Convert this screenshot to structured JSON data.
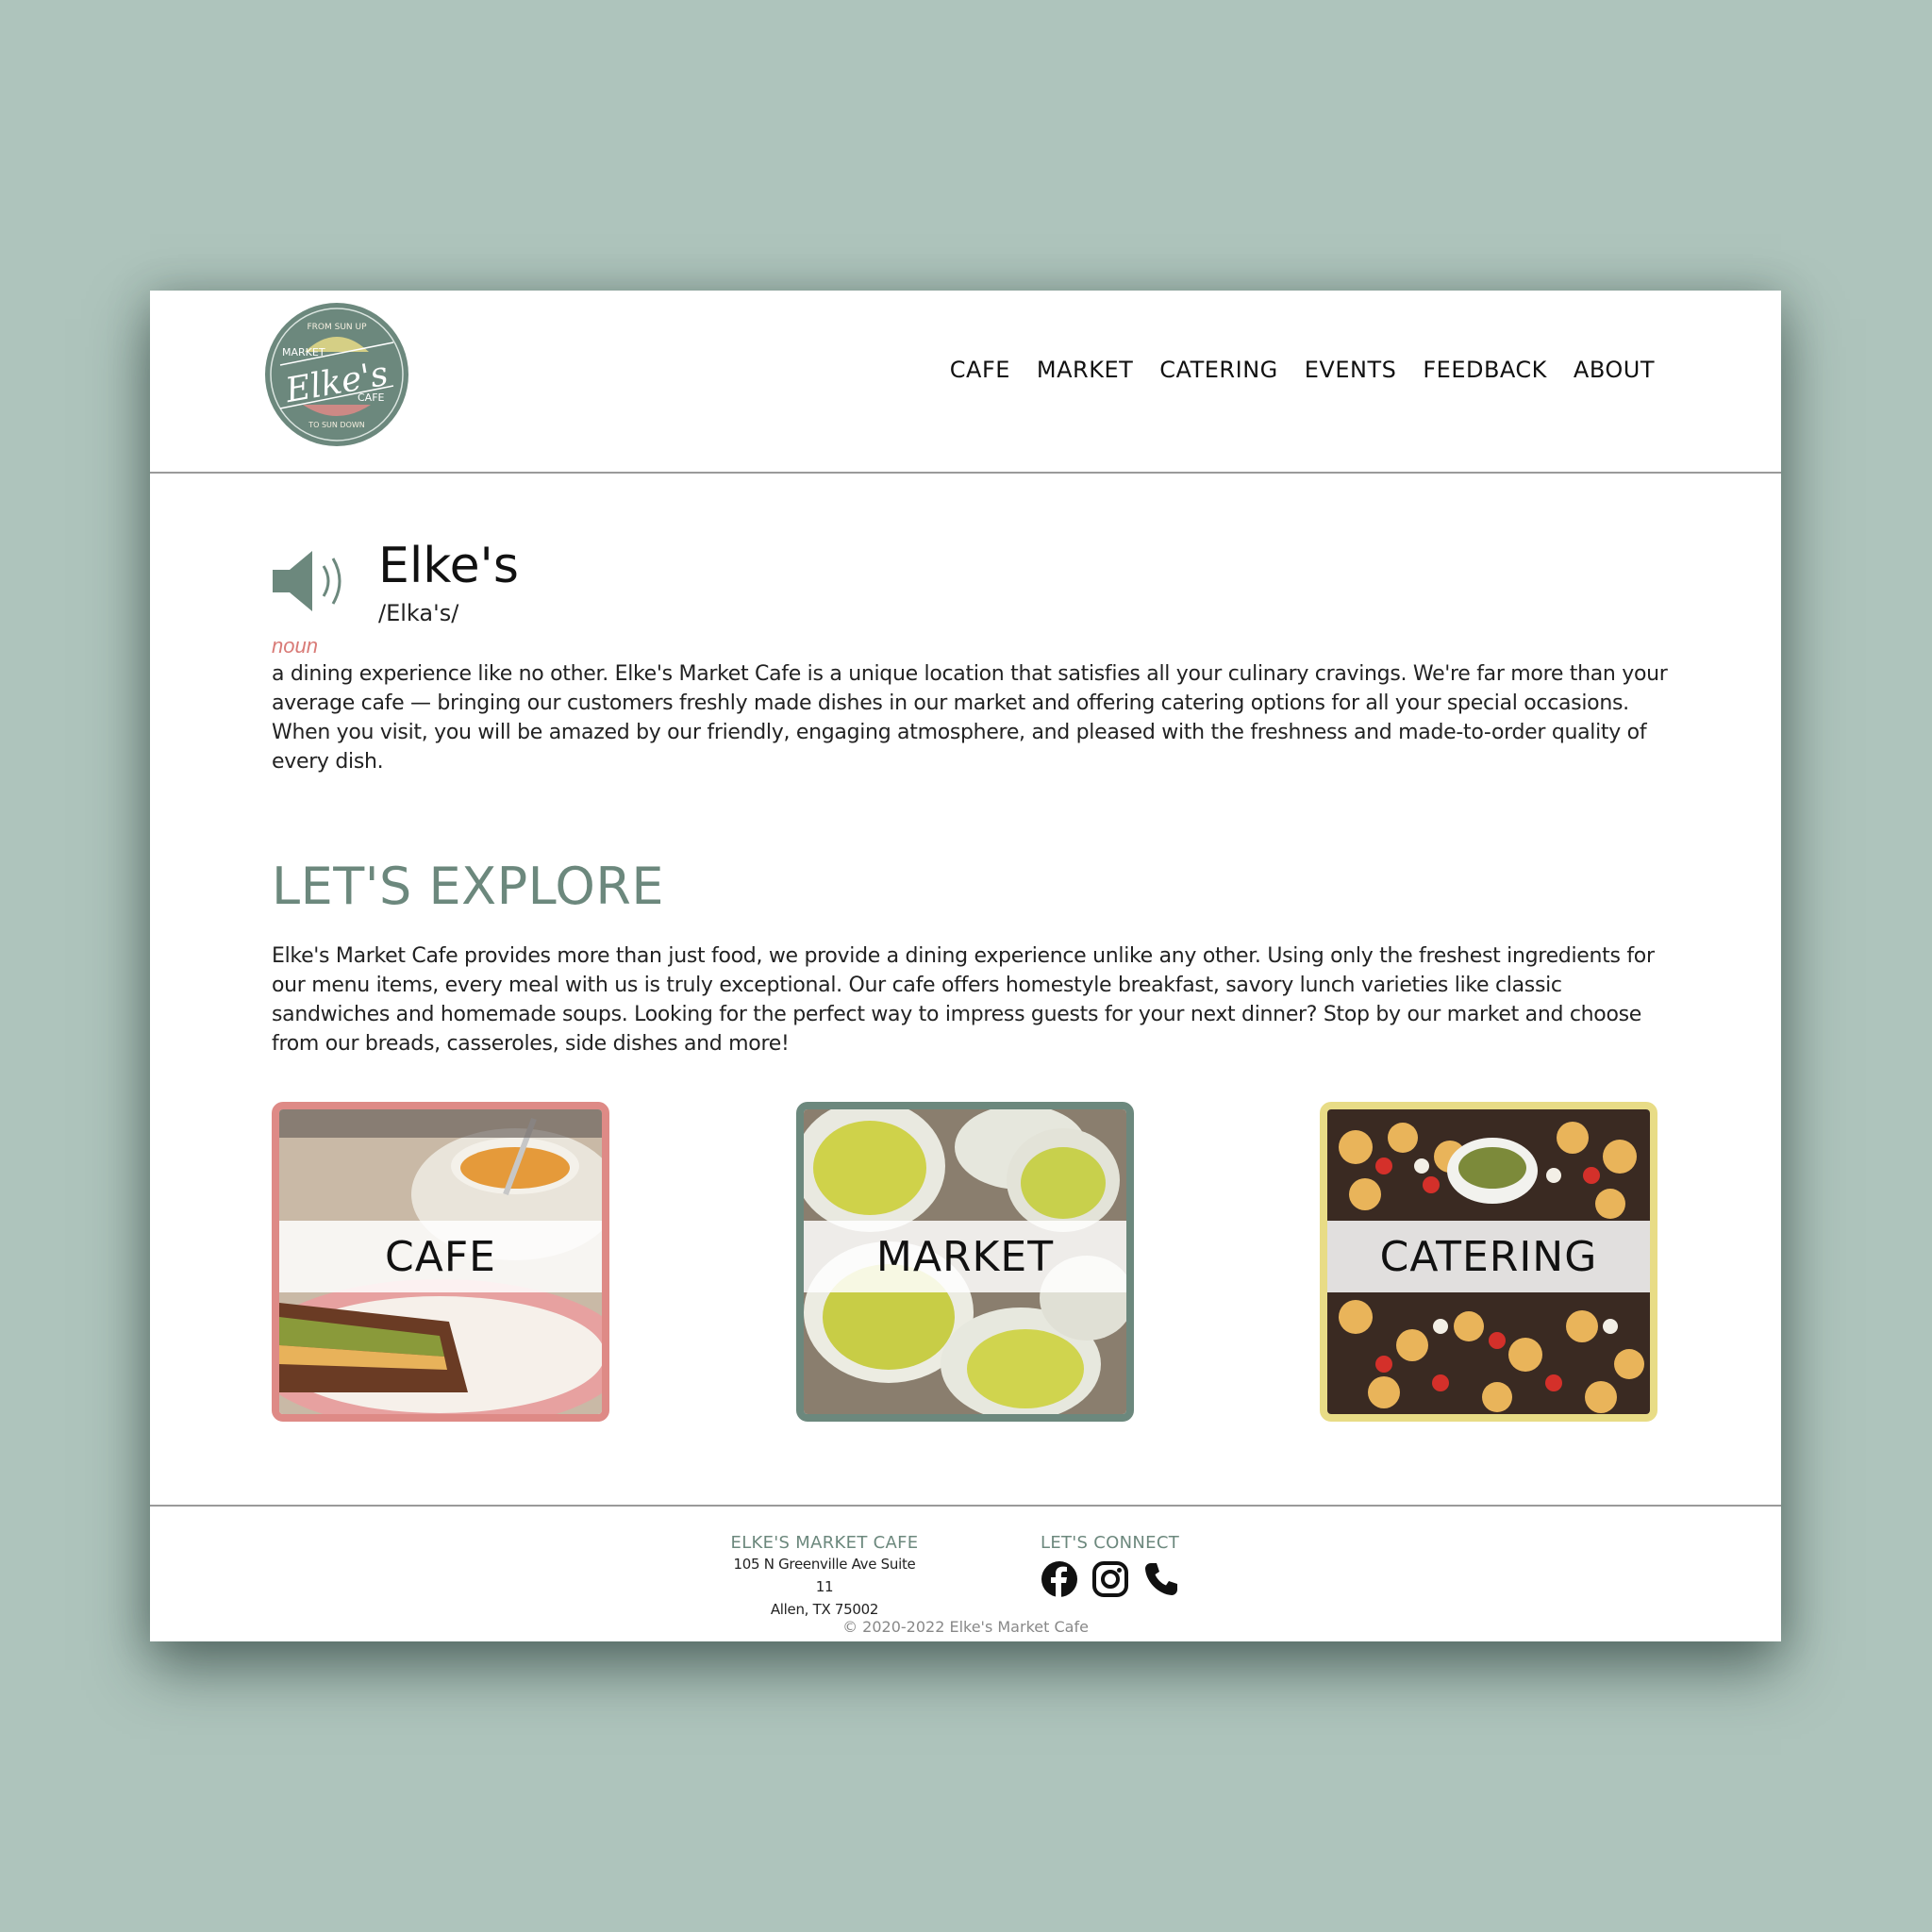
{
  "brand": {
    "logo_top_text": "FROM SUN UP",
    "logo_left_text": "MARKET",
    "logo_name": "Elke's",
    "logo_right_text": "CAFE",
    "logo_bottom_text": "TO SUN DOWN",
    "primary_color": "#6c887d",
    "pink": "#de8a86",
    "yellow": "#e8dc86"
  },
  "nav": {
    "items": [
      "CAFE",
      "MARKET",
      "CATERING",
      "EVENTS",
      "FEEDBACK",
      "ABOUT"
    ]
  },
  "definition": {
    "word": "Elke's",
    "pronunciation": "/Elka's/",
    "part_of_speech": "noun",
    "text": "a dining experience like no other. Elke's Market Cafe is a unique location that satisfies all your culinary cravings. We're far more than your average cafe — bringing our customers freshly made dishes in our market and offering catering options for all your special occasions. When you visit, you will be amazed by our friendly, engaging atmosphere, and pleased with the freshness and made-to-order quality of every dish."
  },
  "explore": {
    "title": "LET'S EXPLORE",
    "text": "Elke's Market Cafe provides more than just food, we provide a dining experience unlike any other. Using only the freshest ingredients for our menu items, every meal with us is truly exceptional. Our cafe offers homestyle breakfast, savory lunch varieties like classic sandwiches and homemade soups. Looking for the perfect way to impress guests for your next dinner? Stop by our market and choose from our breads, casseroles, side dishes and more!",
    "cards": [
      {
        "label": "CAFE",
        "photo_icon": "sandwich-soup-photo"
      },
      {
        "label": "MARKET",
        "photo_icon": "market-containers-photo"
      },
      {
        "label": "CATERING",
        "photo_icon": "catering-platter-photo"
      }
    ]
  },
  "footer": {
    "col1_heading": "ELKE'S MARKET CAFE",
    "address_line1": "105 N Greenville Ave Suite 11",
    "address_line2": "Allen, TX 75002",
    "col2_heading": "LET'S CONNECT",
    "social_icons": [
      "facebook-icon",
      "instagram-icon",
      "phone-icon"
    ],
    "copyright": "© 2020-2022 Elke's Market Cafe"
  }
}
